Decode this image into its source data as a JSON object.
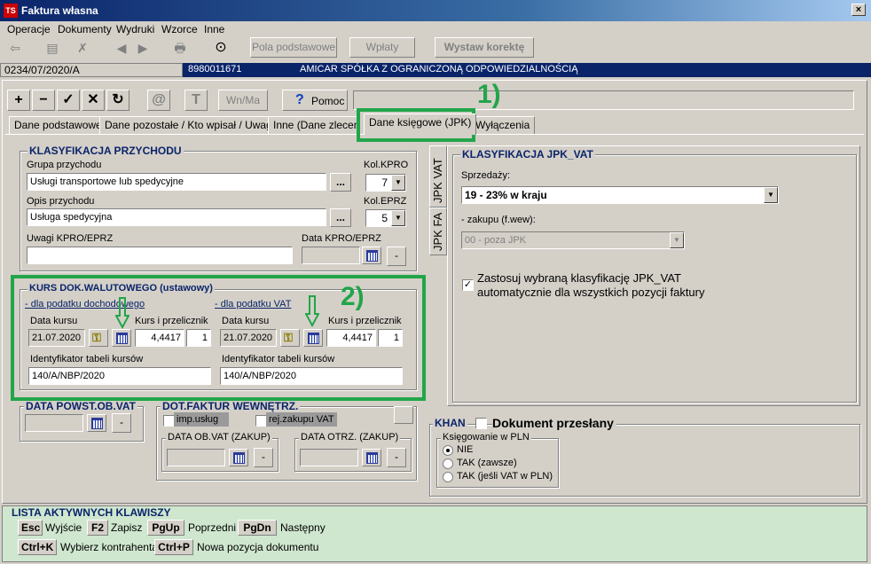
{
  "window": {
    "title": "Faktura własna",
    "icon_text": "TS",
    "close": "×"
  },
  "menu": [
    "Operacje",
    "Dokumenty",
    "Wydruki",
    "Wzorce",
    "Inne"
  ],
  "toolbar": {
    "icons": [
      "back-arrow-icon",
      "print-preview-icon",
      "document-x-icon",
      "prev-icon",
      "next-icon",
      "printer-icon",
      "circle-icon"
    ],
    "btn_basic": "Pola podstawowe",
    "btn_payments": "Wpłaty",
    "btn_correction": "Wystaw korektę"
  },
  "document": {
    "number": "0234/07/2020/A",
    "nip": "8980011671",
    "name": "AMICAR SPÓŁKA Z OGRANICZONĄ ODPOWIEDZIALNOŚCIĄ"
  },
  "edit_toolbar": {
    "add": "+",
    "remove": "−",
    "confirm": "✓",
    "cancel": "✕",
    "refresh": "↻",
    "at": "@",
    "t": "T",
    "wn_ma": "Wn/Ma",
    "help_q": "?",
    "help": "Pomoc"
  },
  "tabs": [
    "Dane podstawowe",
    "Dane pozostałe / Kto wpisał / Uwagi",
    "Inne (Dane zlecenia",
    "Dane księgowe (JPK)",
    "Wyłączenia"
  ],
  "annotations": {
    "one": "1)",
    "two": "2)"
  },
  "klasyfikacja": {
    "title": "KLASYFIKACJA PRZYCHODU",
    "grupa_label": "Grupa przychodu",
    "grupa_value": "Usługi transportowe lub spedycyjne",
    "kol_kpro_label": "Kol.KPRO",
    "kol_kpro_value": "7",
    "opis_label": "Opis przychodu",
    "opis_value": "Usługa spedycyjna",
    "kol_eprz_label": "Kol.EPRZ",
    "kol_eprz_value": "5",
    "uwagi_label": "Uwagi KPRO/EPRZ",
    "uwagi_value": "",
    "data_label": "Data KPRO/EPRZ",
    "data_value": "",
    "dots": "...",
    "dash": "-"
  },
  "kurs": {
    "title": "KURS DOK.WALUTOWEGO (ustawowy)",
    "left": {
      "section": "- dla podatku dochodowego",
      "data_label": "Data kursu",
      "data_value": "21.07.2020",
      "kurs_label": "Kurs i przelicznik",
      "kurs_value": "4,4417",
      "przelicznik": "1",
      "id_label": "Identyfikator tabeli kursów",
      "id_value": "140/A/NBP/2020"
    },
    "right": {
      "section": "- dla podatku VAT",
      "data_label": "Data kursu",
      "data_value": "21.07.2020",
      "kurs_label": "Kurs i przelicznik",
      "kurs_value": "4,4417",
      "przelicznik": "1",
      "id_label": "Identyfikator tabeli kursów",
      "id_value": "140/A/NBP/2020"
    }
  },
  "data_powst": {
    "title": "DATA POWST.OB.VAT",
    "dash": "-"
  },
  "dot_faktur": {
    "title": "DOT.FAKTUR WEWNĘTRZ.",
    "imp": "imp.usług",
    "rej": "rej.zakupu VAT",
    "ob_vat": "DATA OB.VAT (ZAKUP)",
    "otrz": "DATA OTRZ. (ZAKUP)",
    "dash": "-"
  },
  "jpk": {
    "side_tab_vat": "JPK VAT",
    "side_tab_fa": "JPK FA",
    "title": "KLASYFIKACJA JPK_VAT",
    "sprzedazy_label": "Sprzedaży:",
    "sprzedazy_value": "19 - 23% w kraju",
    "zakupu_label": "- zakupu (f.wew):",
    "zakupu_value": "00 - poza JPK",
    "apply_line1": "Zastosuj wybraną klasyfikację JPK_VAT",
    "apply_line2": "automatycznie dla wszystkich pozycji faktury",
    "apply_checked": "✓"
  },
  "khan": {
    "label": "KHAN",
    "doc_sent": "Dokument przesłany",
    "ksieg_label": "Księgowanie w PLN",
    "opt1": "NIE",
    "opt2": "TAK (zawsze)",
    "opt3": "TAK (jeśli VAT w PLN)"
  },
  "keys": {
    "title": "LISTA AKTYWNYCH KLAWISZY",
    "items": [
      {
        "key": "Esc",
        "desc": "Wyjście"
      },
      {
        "key": "F2",
        "desc": "Zapisz"
      },
      {
        "key": "PgUp",
        "desc": "Poprzedni"
      },
      {
        "key": "PgDn",
        "desc": "Następny"
      },
      {
        "key": "Ctrl+K",
        "desc": "Wybierz kontrahenta"
      },
      {
        "key": "Ctrl+P",
        "desc": "Nowa pozycja dokumentu"
      }
    ]
  },
  "colors": {
    "annotation": "#22a54a",
    "title_bar": "#0a246a",
    "footer_bg": "#cfe6cf"
  }
}
